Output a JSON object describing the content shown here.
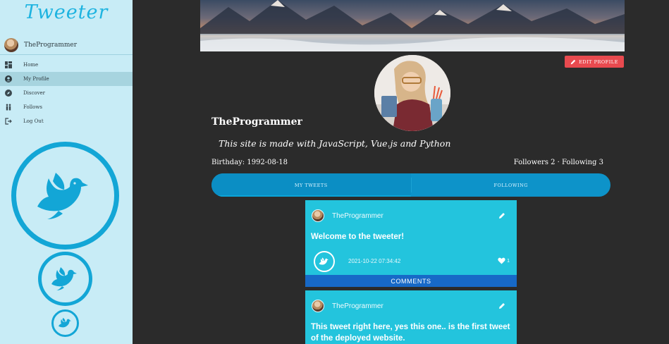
{
  "app": {
    "brand": "Tweeter"
  },
  "sidebar": {
    "user_name": "TheProgrammer",
    "items": [
      {
        "label": "Home",
        "icon": "dashboard-icon"
      },
      {
        "label": "My Profile",
        "icon": "account-circle-icon",
        "active": true
      },
      {
        "label": "Discover",
        "icon": "compass-icon"
      },
      {
        "label": "Follows",
        "icon": "people-icon"
      },
      {
        "label": "Log Out",
        "icon": "logout-icon"
      }
    ]
  },
  "profile": {
    "edit_label": "EDIT PROFILE",
    "name": "TheProgrammer",
    "bio": "This site is made with JavaScript, Vue.js and Python",
    "birthday": "Birthday: 1992-08-18",
    "follow_stats": "Followers 2 · Following 3"
  },
  "tabs": [
    {
      "label": "MY TWEETS",
      "active": true
    },
    {
      "label": "FOLLOWING",
      "active": false
    }
  ],
  "tweets": [
    {
      "user": "TheProgrammer",
      "text": "Welcome to the tweeter!",
      "date": "2021-10-22 07:34:42",
      "likes": "1",
      "comments_label": "COMMENTS"
    },
    {
      "user": "TheProgrammer",
      "text": "This tweet right here, yes this one.. is the first tweet of the deployed website."
    }
  ],
  "colors": {
    "sidebar_bg": "#c8ecf6",
    "accent": "#13a6d6",
    "tweet_bg": "#23c4dd",
    "comments_bg": "#1769c7",
    "edit_button": "#e84a4f",
    "page_bg": "#2b2b2b"
  }
}
